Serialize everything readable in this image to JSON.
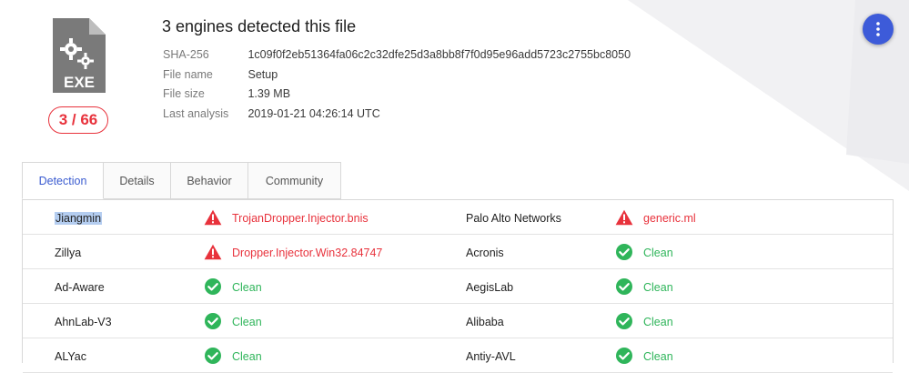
{
  "header": {
    "title": "3 engines detected this file",
    "score": "3 / 66",
    "file_type_label": "EXE",
    "meta": [
      {
        "label": "SHA-256",
        "value": "1c09f0f2eb51364fa06c2c32dfe25d3a8bb8f7f0d95e96add5723c2755bc8050"
      },
      {
        "label": "File name",
        "value": "Setup"
      },
      {
        "label": "File size",
        "value": "1.39 MB"
      },
      {
        "label": "Last analysis",
        "value": "2019-01-21 04:26:14 UTC"
      }
    ]
  },
  "tabs": [
    {
      "label": "Detection",
      "active": true
    },
    {
      "label": "Details",
      "active": false
    },
    {
      "label": "Behavior",
      "active": false
    },
    {
      "label": "Community",
      "active": false
    }
  ],
  "results": [
    {
      "left": {
        "engine": "Jiangmin",
        "status": "malicious",
        "result": "TrojanDropper.Injector.bnis"
      },
      "right": {
        "engine": "Palo Alto Networks",
        "status": "malicious",
        "result": "generic.ml"
      }
    },
    {
      "left": {
        "engine": "Zillya",
        "status": "malicious",
        "result": "Dropper.Injector.Win32.84747"
      },
      "right": {
        "engine": "Acronis",
        "status": "clean",
        "result": "Clean"
      }
    },
    {
      "left": {
        "engine": "Ad-Aware",
        "status": "clean",
        "result": "Clean"
      },
      "right": {
        "engine": "AegisLab",
        "status": "clean",
        "result": "Clean"
      }
    },
    {
      "left": {
        "engine": "AhnLab-V3",
        "status": "clean",
        "result": "Clean"
      },
      "right": {
        "engine": "Alibaba",
        "status": "clean",
        "result": "Clean"
      }
    },
    {
      "left": {
        "engine": "ALYac",
        "status": "clean",
        "result": "Clean"
      },
      "right": {
        "engine": "Antiy-AVL",
        "status": "clean",
        "result": "Clean"
      }
    }
  ],
  "colors": {
    "malicious": "#e8323c",
    "clean": "#2fb55a",
    "accent": "#3a5bd0"
  },
  "icons": {
    "file_type": "exe-file-icon",
    "menu": "more-vertical-icon",
    "malicious": "warning-triangle-icon",
    "clean": "check-circle-icon"
  }
}
